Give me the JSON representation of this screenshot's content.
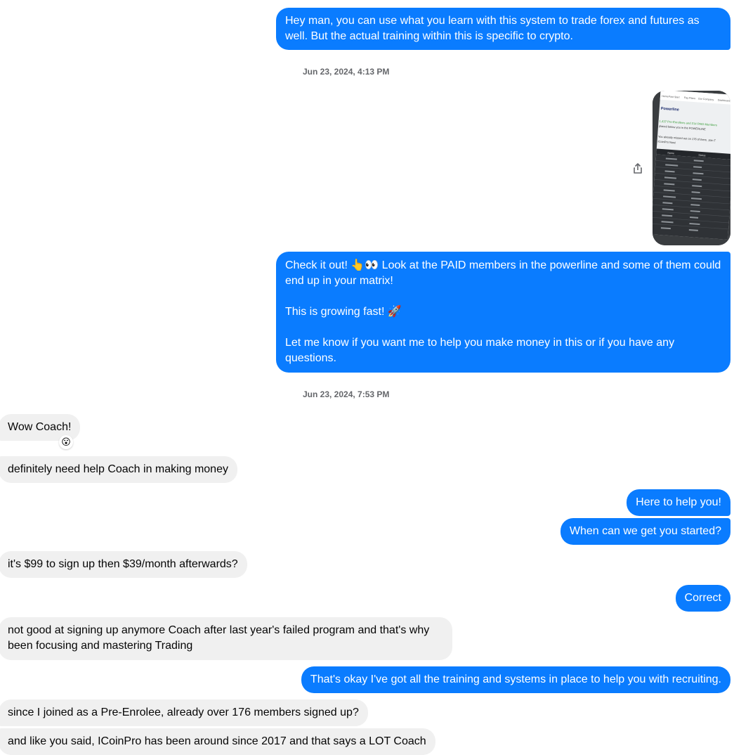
{
  "messages": {
    "m1": "Hey man, you can use what you learn with this system to trade forex and futures as well. But the actual training within this is specific to crypto.",
    "ts1": "Jun 23, 2024, 4:13 PM",
    "image_text": {
      "tab1": "Home",
      "tab2": "Fast Start",
      "tab3": "Pay Plans",
      "tab4": "Our Company",
      "tab5": "Dashboard",
      "heading": "Powerline",
      "line1": "1,437 Pre-Enrollees and 214 PAID Members",
      "line2": "placed below you in the POWERLINE",
      "line3": "You already missed out on 176 of them. Join T",
      "line4": "ICoinPro Now!",
      "col1": "Name",
      "col2": "Status"
    },
    "m2": "Check it out! 👆👀 Look at the PAID members in the powerline and some of them could end up in your matrix!\n\nThis is growing fast! 🚀\n\nLet me know if you want me to help you make money in this or if you have any questions.",
    "ts2": "Jun 23, 2024, 7:53 PM",
    "m3": "Wow Coach!",
    "m3_reaction": "😮",
    "m4": "definitely need help Coach in making money",
    "m5": "Here to help you!",
    "m6": "When can we get you started?",
    "m7": "it's $99 to sign up then $39/month afterwards?",
    "m8": "Correct",
    "m9": "not good at signing up anymore Coach after last year's failed program and that's why been focusing and mastering Trading",
    "m10": "That's okay I've got all the training and systems in place to help you with recruiting.",
    "m11": "since I joined as a Pre-Enrolee, already over 176 members signed up?",
    "m12": "and like you said, ICoinPro has been around since 2017 and that says a LOT Coach"
  },
  "colors": {
    "outgoing": "#0a7cff",
    "incoming": "#f0f0f0",
    "timestamp": "#65676b"
  },
  "icons": {
    "share": "share-icon"
  }
}
